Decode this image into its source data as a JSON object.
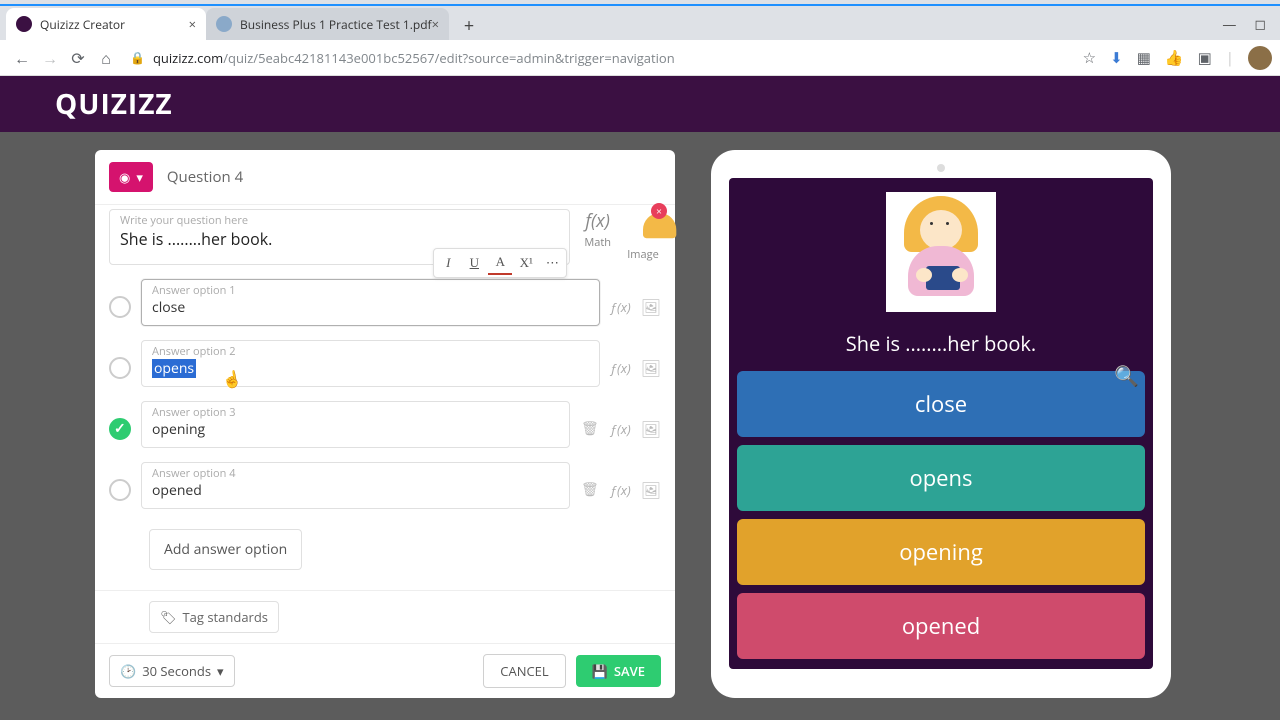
{
  "browser": {
    "tabs": [
      {
        "title": "Quizizz Creator",
        "active": true
      },
      {
        "title": "Business Plus 1 Practice Test 1.pdf",
        "active": false
      }
    ],
    "url_host": "quizizz.com",
    "url_path": "/quiz/5eabc42181143e001bc52567/edit?source=admin&trigger=navigation"
  },
  "app": {
    "logo": "QUIZIZZ"
  },
  "editor": {
    "question_label": "Question 4",
    "question_placeholder": "Write your question here",
    "question_text": "She is ........her book.",
    "math_label": "Math",
    "math_icon": "f(x)",
    "image_label": "Image",
    "format": {
      "italic": "I",
      "underline": "U",
      "color": "A",
      "super": "X¹",
      "more": "⋯"
    },
    "options": [
      {
        "label": "Answer option 1",
        "value": "close",
        "correct": false,
        "selected": false,
        "deletable": false
      },
      {
        "label": "Answer option 2",
        "value": "opens",
        "correct": false,
        "selected": true,
        "deletable": false
      },
      {
        "label": "Answer option 3",
        "value": "opening",
        "correct": true,
        "selected": false,
        "deletable": true
      },
      {
        "label": "Answer option 4",
        "value": "opened",
        "correct": false,
        "selected": false,
        "deletable": true
      }
    ],
    "add_option": "Add answer option",
    "tag_standards": "Tag standards",
    "time": "30 Seconds",
    "cancel": "CANCEL",
    "save": "SAVE"
  },
  "preview": {
    "question": "She is ........her book.",
    "answers": [
      "close",
      "opens",
      "opening",
      "opened"
    ]
  }
}
